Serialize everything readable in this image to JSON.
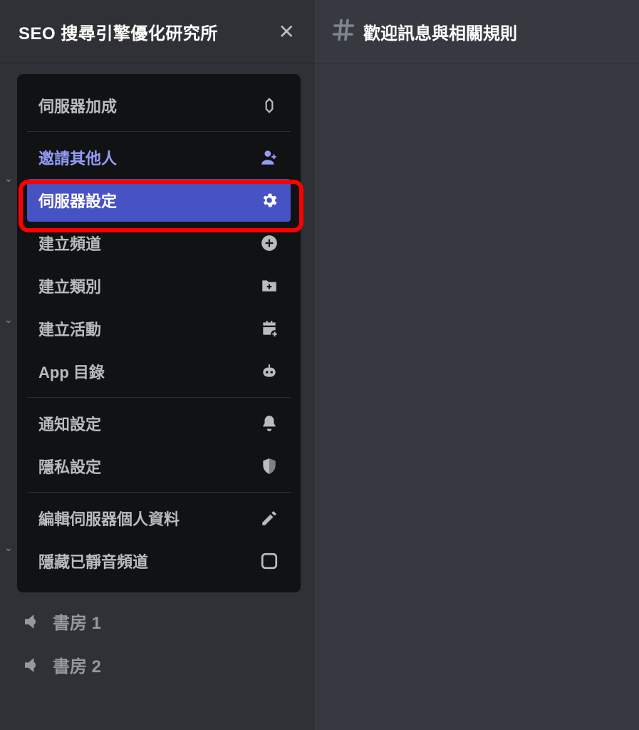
{
  "server": {
    "name": "SEO 搜尋引擎優化研究所"
  },
  "channel": {
    "name": "歡迎訊息與相關規則"
  },
  "menu": {
    "boost": {
      "label": "伺服器加成"
    },
    "invite": {
      "label": "邀請其他人"
    },
    "settings": {
      "label": "伺服器設定"
    },
    "create_channel": {
      "label": "建立頻道"
    },
    "create_category": {
      "label": "建立類別"
    },
    "create_event": {
      "label": "建立活動"
    },
    "app_directory": {
      "label": "App 目錄"
    },
    "notification": {
      "label": "通知設定"
    },
    "privacy": {
      "label": "隱私設定"
    },
    "edit_profile": {
      "label": "編輯伺服器個人資料"
    },
    "hide_muted": {
      "label": "隱藏已靜音頻道"
    }
  },
  "voice_channels": [
    {
      "name": "書房 1"
    },
    {
      "name": "書房 2"
    }
  ]
}
